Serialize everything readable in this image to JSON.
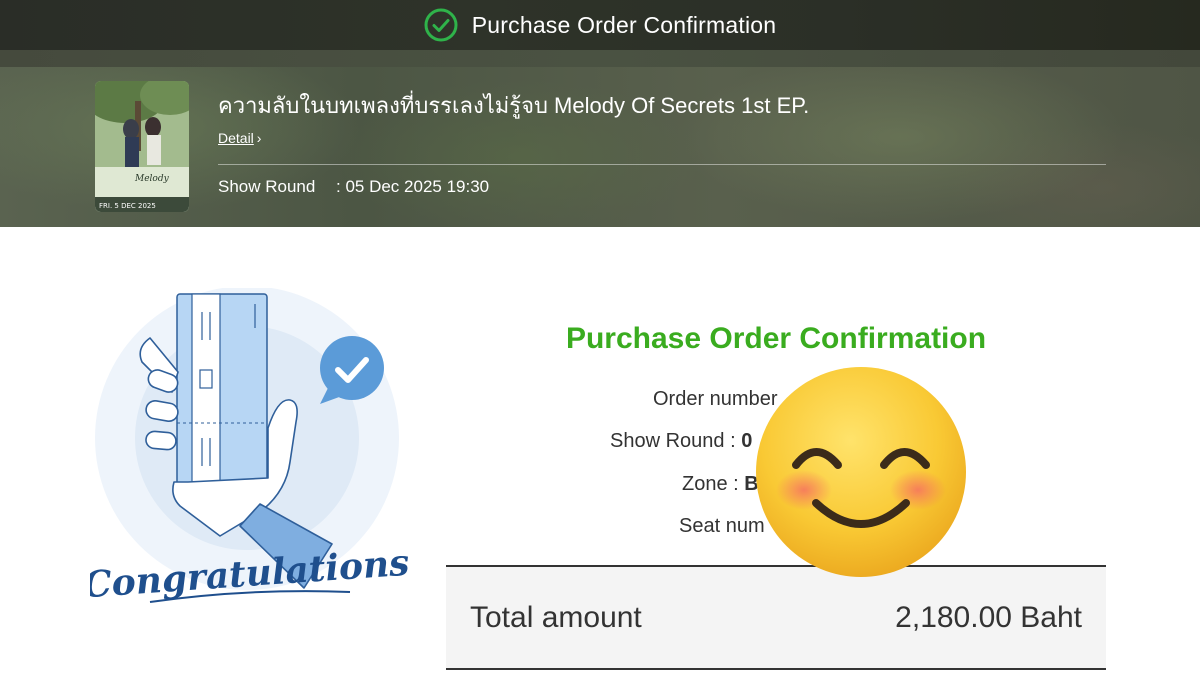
{
  "header": {
    "title": "Purchase Order Confirmation",
    "icon": "check-circle-icon",
    "accent": "#2fb34a"
  },
  "event": {
    "title": "ความลับในบทเพลงที่บรรเลงไม่รู้จบ Melody Of Secrets 1st EP.",
    "detail_label": "Detail",
    "show_round_label": "Show Round",
    "show_round_value": ": 05 Dec 2025 19:30",
    "poster_date_text": "FRI. 5 DEC 2025"
  },
  "illustration": {
    "caption": "Congratulations",
    "icons": [
      "hand-holding-ticket-icon",
      "check-bubble-icon"
    ]
  },
  "order": {
    "heading": "Purchase Order Confirmation",
    "heading_color": "#3aac1f",
    "order_number_label": "Order number",
    "show_round_label": "Show Round :",
    "show_round_value_partial": "0",
    "zone_label": "Zone :",
    "zone_value_partial": "B",
    "seat_label_partial": "Seat num"
  },
  "total": {
    "label": "Total amount",
    "value": "2,180.00 Baht"
  },
  "overlay": {
    "icon": "smiling-face-emoji-icon"
  }
}
